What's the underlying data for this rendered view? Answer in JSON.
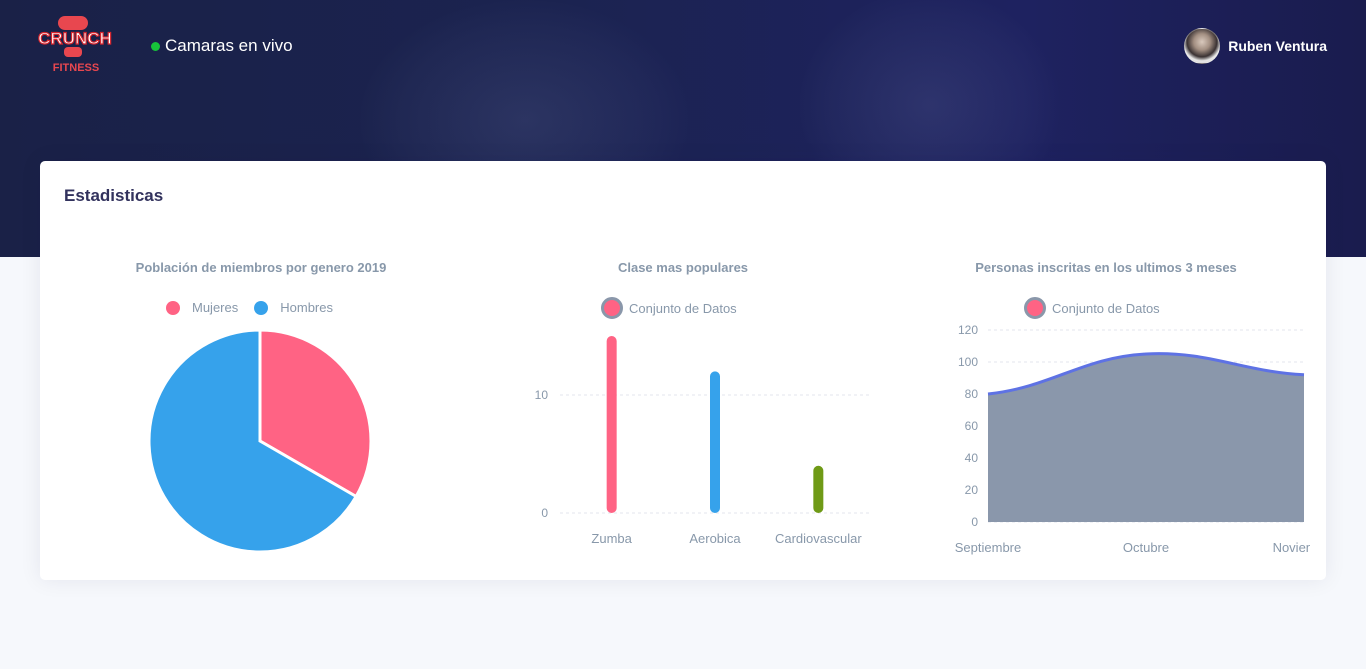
{
  "header": {
    "logo_text_top": "CRUNCH",
    "logo_text_bottom": "FITNESS",
    "live_status_label": "Camaras en vivo",
    "user_name": "Ruben Ventura"
  },
  "card": {
    "title": "Estadisticas"
  },
  "colors": {
    "pink": "#ff6384",
    "blue": "#36a2eb",
    "olive": "#6f9a16",
    "area_fill": "#8a97ab",
    "area_line": "#5e72e4",
    "live_dot": "#17c33a"
  },
  "chart_data": [
    {
      "type": "pie",
      "title": "Población de miembros por genero 2019",
      "legend": [
        "Mujeres",
        "Hombres"
      ],
      "categories": [
        "Mujeres",
        "Hombres"
      ],
      "values": [
        1,
        2
      ],
      "colors": [
        "#ff6384",
        "#36a2eb"
      ],
      "legend_position": "top"
    },
    {
      "type": "bar",
      "title": "Clase mas populares",
      "legend": [
        "Conjunto de Datos"
      ],
      "categories": [
        "Zumba",
        "Aerobica",
        "Cardiovascular"
      ],
      "series": [
        {
          "name": "Conjunto de Datos",
          "values": [
            15,
            12,
            4
          ]
        }
      ],
      "colors": [
        "#ff6384",
        "#36a2eb",
        "#6f9a16"
      ],
      "yticks": [
        "0",
        "10"
      ],
      "ylim": [
        0,
        15
      ],
      "grid": true,
      "legend_position": "top"
    },
    {
      "type": "area",
      "title": "Personas inscritas en los ultimos 3 meses",
      "legend": [
        "Conjunto de Datos"
      ],
      "categories": [
        "Septiembre",
        "Octubre",
        "Noviembre"
      ],
      "series": [
        {
          "name": "Conjunto de Datos",
          "values": [
            80,
            105,
            92
          ]
        }
      ],
      "yticks": [
        "0",
        "20",
        "40",
        "60",
        "80",
        "100",
        "120"
      ],
      "ylim": [
        0,
        120
      ],
      "grid": true,
      "legend_position": "top"
    }
  ]
}
